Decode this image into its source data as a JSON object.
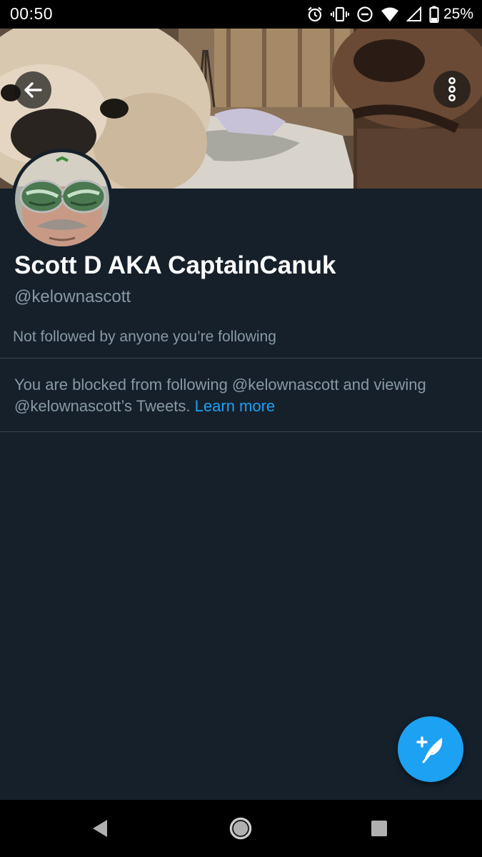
{
  "status_bar": {
    "time": "00:50",
    "battery_percent": "25%",
    "icons": [
      "alarm-icon",
      "vibrate-icon",
      "do-not-disturb-icon",
      "wifi-icon",
      "cell-signal-icon",
      "battery-icon"
    ]
  },
  "header": {
    "back_icon": "arrow-left-icon",
    "more_icon": "vertical-dots-icon"
  },
  "profile": {
    "display_name": "Scott D AKA CaptainCanuk",
    "handle": "@kelownascott",
    "followers_note": "Not followed by anyone you’re following"
  },
  "blocked_notice": {
    "message": "You are blocked from following @kelownascott and viewing @kelownascott’s Tweets.",
    "link_text": "Learn more"
  },
  "fab": {
    "icon": "compose-tweet-icon"
  },
  "nav_bar": {
    "icons": [
      "nav-back-icon",
      "nav-home-icon",
      "nav-recents-icon"
    ]
  },
  "colors": {
    "background": "#15202b",
    "accent": "#1da1f2",
    "secondary_text": "#8899a6",
    "divider": "#38444d"
  }
}
